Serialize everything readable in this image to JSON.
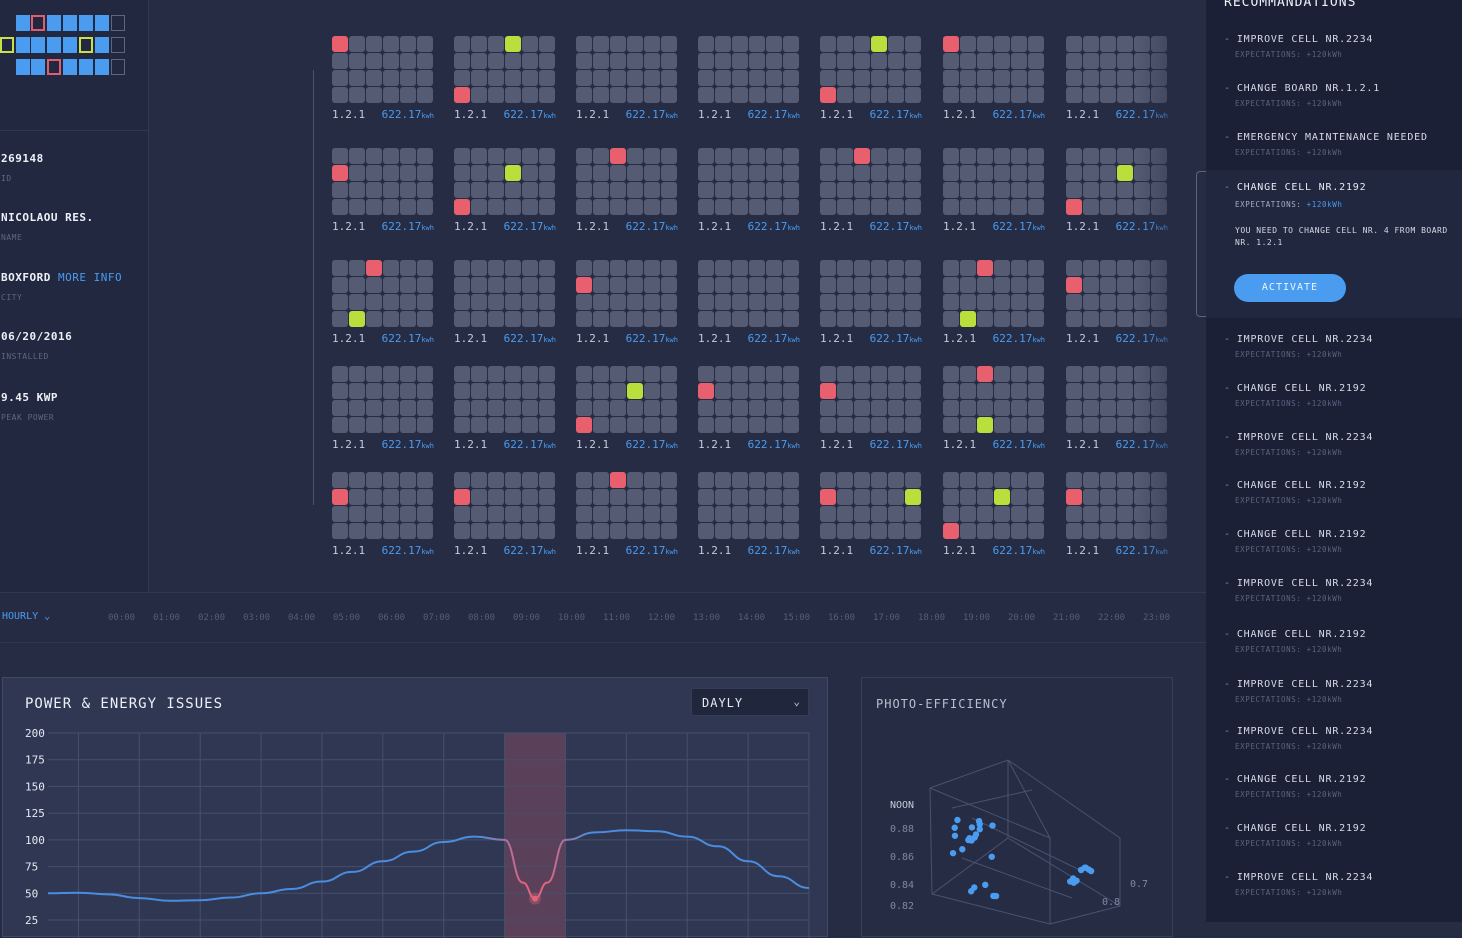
{
  "sidebar": {
    "site_id": "269148",
    "site_id_label": "ID",
    "name": "NICOLAOU RES.",
    "name_label": "NAME",
    "city": "BOXFORD",
    "more_info": "MORE INFO",
    "city_label": "CITY",
    "installed": "06/20/2016",
    "installed_label": "INSTALLED",
    "peak_power": "9.45 KWP",
    "peak_power_label": "PEAK POWER"
  },
  "boards": {
    "board_label": "1.2.1",
    "energy_value": "622.17",
    "energy_unit": "kwh",
    "rows": [
      [
        {
          "r": [
            0
          ],
          "g": []
        },
        {
          "r": [
            18
          ],
          "g": [
            3
          ]
        },
        {
          "r": [],
          "g": []
        },
        {
          "r": [],
          "g": []
        },
        {
          "r": [
            18
          ],
          "g": [
            3
          ]
        },
        {
          "r": [
            0
          ],
          "g": []
        },
        {
          "r": [],
          "g": []
        }
      ],
      [
        {
          "r": [
            6
          ],
          "g": []
        },
        {
          "r": [
            18
          ],
          "g": [
            9
          ]
        },
        {
          "r": [
            2
          ],
          "g": []
        },
        {
          "r": [],
          "g": []
        },
        {
          "r": [
            2
          ],
          "g": []
        },
        {
          "r": [],
          "g": []
        },
        {
          "r": [
            18
          ],
          "g": [
            9
          ]
        }
      ],
      [
        {
          "r": [
            2
          ],
          "g": [
            19
          ]
        },
        {
          "r": [],
          "g": []
        },
        {
          "r": [
            6
          ],
          "g": []
        },
        {
          "r": [],
          "g": []
        },
        {
          "r": [],
          "g": []
        },
        {
          "r": [
            2
          ],
          "g": [
            19
          ]
        },
        {
          "r": [
            6
          ],
          "g": []
        }
      ],
      [
        {
          "r": [],
          "g": []
        },
        {
          "r": [],
          "g": []
        },
        {
          "r": [
            18
          ],
          "g": [
            9
          ]
        },
        {
          "r": [
            6
          ],
          "g": []
        },
        {
          "r": [
            6
          ],
          "g": []
        },
        {
          "r": [
            2
          ],
          "g": [
            20
          ]
        },
        {
          "r": [],
          "g": []
        }
      ],
      [
        {
          "r": [
            6
          ],
          "g": []
        },
        {
          "r": [
            6
          ],
          "g": []
        },
        {
          "r": [
            2
          ],
          "g": []
        },
        {
          "r": [],
          "g": []
        },
        {
          "r": [
            6
          ],
          "g": [
            11
          ]
        },
        {
          "r": [
            18
          ],
          "g": [
            9
          ]
        },
        {
          "r": [
            6
          ],
          "g": []
        }
      ]
    ]
  },
  "timeline": {
    "mode": "HOURLY",
    "hours": [
      "00:00",
      "01:00",
      "02:00",
      "03:00",
      "04:00",
      "05:00",
      "06:00",
      "07:00",
      "08:00",
      "09:00",
      "10:00",
      "11:00",
      "12:00",
      "13:00",
      "14:00",
      "15:00",
      "16:00",
      "17:00",
      "18:00",
      "19:00",
      "20:00",
      "21:00",
      "22:00",
      "23:00"
    ]
  },
  "power_chart": {
    "title": "POWER & ENERGY ISSUES",
    "period": "DAYLY",
    "chart_data": {
      "type": "line",
      "title": "POWER & ENERGY ISSUES",
      "y_ticks": [
        200,
        175,
        150,
        125,
        100,
        75,
        50,
        25
      ],
      "ylim": [
        25,
        200
      ],
      "grid": true,
      "highlight_region": {
        "x_start": 7.5,
        "x_end": 8.5
      },
      "series": [
        {
          "color": "#4a8de0",
          "highlight_color": "#e2637e",
          "points": [
            [
              0,
              50
            ],
            [
              0.5,
              50.5
            ],
            [
              1,
              49
            ],
            [
              1.5,
              45.5
            ],
            [
              2,
              43
            ],
            [
              2.5,
              43.5
            ],
            [
              3,
              46
            ],
            [
              3.5,
              50
            ],
            [
              4,
              54
            ],
            [
              4.5,
              61
            ],
            [
              5,
              70
            ],
            [
              5.5,
              80
            ],
            [
              6,
              89
            ],
            [
              6.5,
              98
            ],
            [
              7,
              103
            ],
            [
              7.5,
              100
            ],
            [
              7.8,
              60
            ],
            [
              8,
              45
            ],
            [
              8.2,
              60
            ],
            [
              8.5,
              100
            ],
            [
              9,
              107
            ],
            [
              9.5,
              109
            ],
            [
              10,
              108
            ],
            [
              10.5,
              103
            ],
            [
              11,
              94
            ],
            [
              11.5,
              80
            ],
            [
              12,
              66
            ],
            [
              12.5,
              55
            ]
          ]
        }
      ]
    }
  },
  "photo_chart": {
    "title": "PHOTO-EFFICIENCY",
    "chart_data": {
      "type": "scatter",
      "title": "PHOTO-EFFICIENCY",
      "z_label": "NOON",
      "z_ticks": [
        "0.88",
        "0.86",
        "0.84",
        "0.82"
      ],
      "x_ticks": [
        "0.7",
        "0.8"
      ],
      "point_color": "#4a9cf0",
      "point_count": 30
    }
  },
  "recommendations": {
    "title": "RECOMMANDATIONS",
    "expectation_prefix": "EXPECTATIONS:",
    "expectation_value": "+120kWh",
    "items": [
      {
        "text": "IMPROVE CELL NR.2234",
        "exp": "EXPECTATIONS: +120kWh"
      },
      {
        "text": "CHANGE BOARD NR.1.2.1",
        "exp": "EXPECTATIONS: +120kWh"
      },
      {
        "text": "EMERGENCY MAINTENANCE NEEDED",
        "exp": "EXPECTATIONS: +120kWh"
      }
    ],
    "active": {
      "text": "CHANGE CELL NR.2192",
      "exp_prefix": "EXPECTATIONS:",
      "exp_value": "+120kWh",
      "message": "YOU NEED TO CHANGE CELL NR. 4 FROM BOARD NR. 1.2.1",
      "button": "ACTIVATE"
    },
    "items_after": [
      {
        "text": "IMPROVE CELL NR.2234",
        "exp": "EXPECTATIONS: +120kWh"
      },
      {
        "text": "CHANGE CELL NR.2192",
        "exp": "EXPECTATIONS: +120kWh"
      },
      {
        "text": "IMPROVE CELL NR.2234",
        "exp": "EXPECTATIONS: +120kWh"
      },
      {
        "text": "CHANGE CELL NR.2192",
        "exp": "EXPECTATIONS: +120kWh"
      },
      {
        "text": "CHANGE CELL NR.2192",
        "exp": "EXPECTATIONS: +120kWh"
      },
      {
        "text": "IMPROVE CELL NR.2234",
        "exp": "EXPECTATIONS: +120kWh"
      },
      {
        "text": "CHANGE CELL NR.2192",
        "exp": "EXPECTATIONS: +120kWh"
      },
      {
        "text": "IMPROVE CELL NR.2234",
        "exp": "EXPECTATIONS: +120kWh"
      },
      {
        "text": "IMPROVE CELL NR.2234",
        "exp": "EXPECTATIONS: +120kWh"
      },
      {
        "text": "CHANGE CELL NR.2192",
        "exp": "EXPECTATIONS: +120kWh"
      },
      {
        "text": "CHANGE CELL NR.2192",
        "exp": "EXPECTATIONS: +120kWh"
      },
      {
        "text": "IMPROVE CELL NR.2234",
        "exp": "EXPECTATIONS: +120kWh"
      }
    ]
  }
}
